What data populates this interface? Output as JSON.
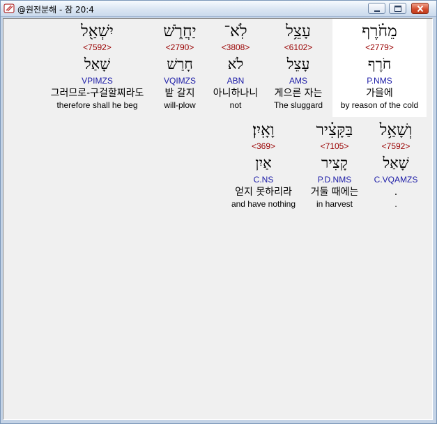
{
  "window": {
    "title": "@원전분해 - 잠 20:4"
  },
  "words": [
    {
      "hebrew": "מֵחֹ֗רֶף",
      "strong": "<2779>",
      "lemma": "חֹרֶף",
      "parse": "P.NMS",
      "korean": "가을에",
      "english": "by reason of the cold",
      "highlighted": true
    },
    {
      "hebrew": "עָצֵ֥ל",
      "strong": "<6102>",
      "lemma": "עָצֵל",
      "parse": "AMS",
      "korean": "게으른 자는",
      "english": "The sluggard",
      "highlighted": false
    },
    {
      "hebrew": "לֹֽא־",
      "strong": "<3808>",
      "lemma": "לֹא",
      "parse": "ABN",
      "korean": "아니하나니",
      "english": "not",
      "highlighted": false
    },
    {
      "hebrew": "יַחֲרֹ֑שׁ",
      "strong": "<2790>",
      "lemma": "חָרַשׁ",
      "parse": "VQIMZS",
      "korean": "밭 갈지",
      "english": "will-plow",
      "highlighted": false
    },
    {
      "hebrew": "יִשְׁאַ֖ל",
      "strong": "<7592>",
      "lemma": "שָׁאַל",
      "parse": "VPIMZS",
      "korean": "그러므로-구걸할찌라도",
      "english": "therefore shall he beg",
      "highlighted": false
    },
    {
      "hebrew": "וְשָׁאַ֥ל",
      "strong": "<7592>",
      "lemma": "שָׁאַל",
      "parse": "C.VQAMZS",
      "korean": ".",
      "english": ".",
      "highlighted": false
    },
    {
      "hebrew": "בַּקָּצִ֗יר",
      "strong": "<7105>",
      "lemma": "קָצִיר",
      "parse": "P.D.NMS",
      "korean": "거둘 때에는",
      "english": "in harvest",
      "highlighted": false
    },
    {
      "hebrew": "וָאָֽיִן׃",
      "strong": "<369>",
      "lemma": "אַיִן",
      "parse": "C.NS",
      "korean": "얻지 못하리라",
      "english": "and have nothing",
      "highlighted": false
    }
  ]
}
